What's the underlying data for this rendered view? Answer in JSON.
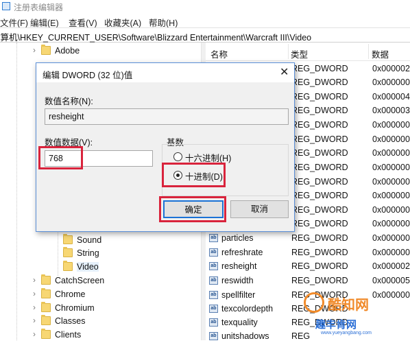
{
  "window": {
    "title": "注册表编辑器"
  },
  "menu": [
    "文件(F)",
    "编辑(E)",
    "查看(V)",
    "收藏夹(A)",
    "帮助(H)"
  ],
  "address": "计算机\\HKEY_CURRENT_USER\\Software\\Blizzard Entertainment\\Warcraft III\\Video",
  "tree": {
    "items": [
      {
        "label": "Adobe",
        "expander": "›"
      },
      {
        "label": "Sound",
        "expander": ""
      },
      {
        "label": "String",
        "expander": ""
      },
      {
        "label": "Video",
        "expander": "",
        "selected": true
      },
      {
        "label": "CatchScreen",
        "expander": "›"
      },
      {
        "label": "Chrome",
        "expander": "›"
      },
      {
        "label": "Chromium",
        "expander": "›"
      },
      {
        "label": "Classes",
        "expander": "›"
      },
      {
        "label": "Clients",
        "expander": "›"
      }
    ]
  },
  "list": {
    "headers": {
      "name": "名称",
      "type": "类型",
      "data": "数据"
    },
    "rows_top": [
      {
        "type": "REG_DWORD",
        "data": "0x000002"
      },
      {
        "type": "REG_DWORD",
        "data": "0x000000"
      },
      {
        "type": "REG_DWORD",
        "data": "0x000004"
      },
      {
        "type": "REG_DWORD",
        "data": "0x000003"
      },
      {
        "type": "REG_DWORD",
        "data": "0x000000"
      },
      {
        "type": "REG_DWORD",
        "data": "0x000000"
      },
      {
        "type": "REG_DWORD",
        "data": "0x000000"
      },
      {
        "type": "REG_DWORD",
        "data": "0x000000"
      },
      {
        "type": "REG_DWORD",
        "data": "0x000000"
      },
      {
        "type": "REG_DWORD",
        "data": "0x000000"
      },
      {
        "type": "REG_DWORD",
        "data": "0x000000"
      },
      {
        "type": "REG_DWORD",
        "data": "0x000000"
      },
      {
        "type": "REG_DWORD",
        "data": "0x000000"
      }
    ],
    "rows_bottom": [
      {
        "name": "particles",
        "type": "REG_DWORD",
        "data": "0x000000"
      },
      {
        "name": "refreshrate",
        "type": "REG_DWORD",
        "data": "0x000000"
      },
      {
        "name": "resheight",
        "type": "REG_DWORD",
        "data": "0x000002"
      },
      {
        "name": "reswidth",
        "type": "REG_DWORD",
        "data": "0x000005"
      },
      {
        "name": "spellfilter",
        "type": "REG_DWORD",
        "data": "0x000000"
      },
      {
        "name": "texcolordepth",
        "type": "REG_DWORD",
        "data": ""
      },
      {
        "name": "texquality",
        "type": "REG_DWORD",
        "data": ""
      },
      {
        "name": "unitshadows",
        "type": "REG",
        "data": ""
      }
    ],
    "value_icon_text": "ab"
  },
  "dialog": {
    "title": "编辑 DWORD (32 位)值",
    "close": "✕",
    "name_label": "数值名称(N):",
    "name_value": "resheight",
    "data_label": "数值数据(V):",
    "data_value": "768",
    "base_label": "基数",
    "hex_label": "十六进制(H)",
    "hex_selected": false,
    "dec_label": "十进制(D)",
    "dec_selected": true,
    "ok_label": "确定",
    "cancel_label": "取消"
  },
  "watermark": {
    "text": "酷知网",
    "text2": "趣丰肯网",
    "url": "www.yueyangbang.com"
  },
  "colors": {
    "highlight": "#d9233c",
    "accent": "#1a72d6",
    "folder": "#f7d774"
  }
}
